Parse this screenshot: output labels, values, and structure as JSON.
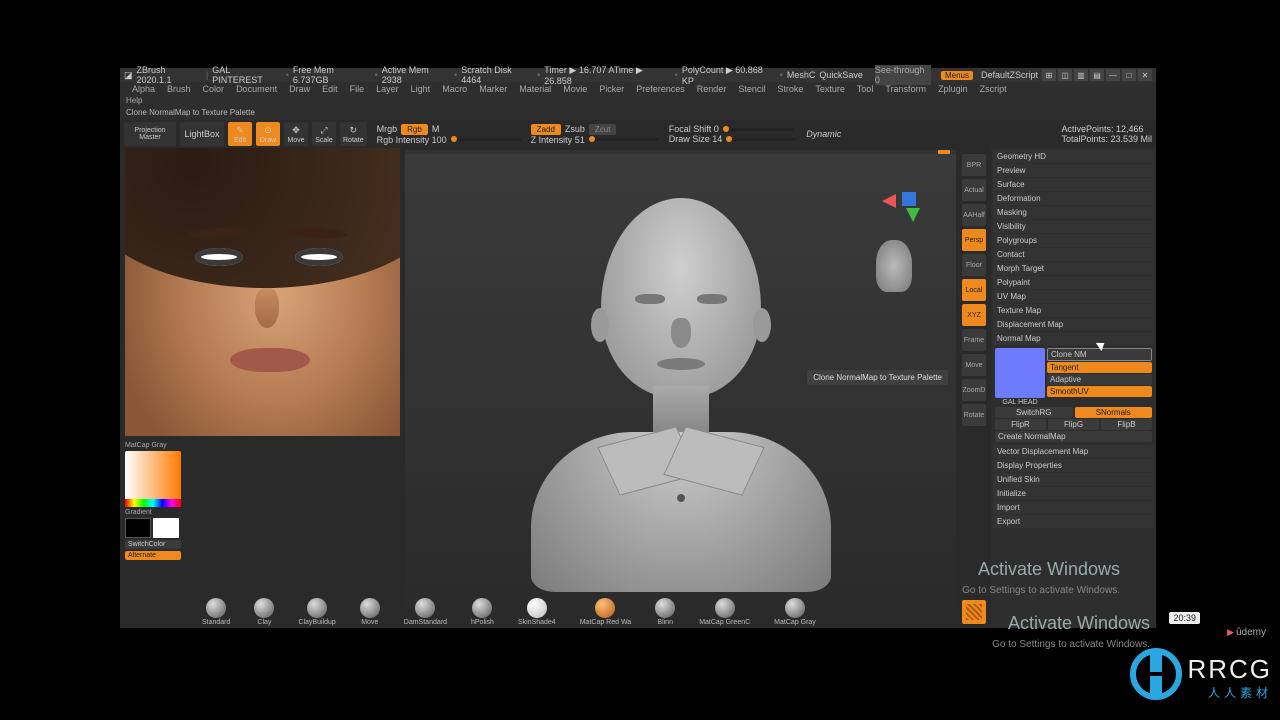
{
  "titlebar": {
    "app": "ZBrush 2020.1.1",
    "doc": "GAL PINTEREST",
    "stats": [
      "Free Mem 6.737GB",
      "Active Mem 2938",
      "Scratch Disk 4464",
      "Timer ▶ 16.707 ATime ▶ 26.858",
      "PolyCount ▶ 60.868 KP",
      "MeshC"
    ],
    "quicksave": "QuickSave",
    "seethrough": "See-through  0",
    "menus": "Menus",
    "zscript": "DefaultZScript"
  },
  "menus": [
    "Alpha",
    "Brush",
    "Color",
    "Document",
    "Draw",
    "Edit",
    "File",
    "Layer",
    "Light",
    "Macro",
    "Marker",
    "Material",
    "Movie",
    "Picker",
    "Preferences",
    "Render",
    "Stencil",
    "Stroke",
    "Texture",
    "Tool",
    "Transform",
    "Zplugin",
    "Zscript"
  ],
  "helpbar": "Help",
  "subinfo": "Clone NormalMap to Texture Palette",
  "toolbar": {
    "projection": "Projection\nMaster",
    "lightbox": "LightBox",
    "modeButtons": [
      "Edit",
      "Draw",
      "Move",
      "Scale",
      "Rotate"
    ],
    "mrgb": "Mrgb",
    "rgb": "Rgb",
    "m": "M",
    "rgbIntensity": "Rgb Intensity 100",
    "zadd": "Zadd",
    "zsub": "Zsub",
    "zcut": "Zcut",
    "zIntensity": "Z Intensity 51",
    "focal": "Focal Shift 0",
    "drawsize": "Draw Size 14",
    "dynamic": "Dynamic",
    "activepoints": "ActivePoints: 12,466",
    "totalpoints": "TotalPoints: 23.539 Mil"
  },
  "canvas": {
    "tooltip": "Clone NormalMap to Texture Palette"
  },
  "rightIcons": [
    "BPR",
    "Actual",
    "AAHalf",
    "Persp",
    "Floor",
    "Local",
    "XYZ",
    "Frame",
    "Move",
    "ZoomD",
    "Rotate"
  ],
  "rightIconsHot": [
    false,
    false,
    false,
    true,
    false,
    true,
    true,
    false,
    false,
    false,
    false
  ],
  "sidepanel": {
    "items": [
      "Geometry HD",
      "Preview",
      "Surface",
      "Deformation",
      "Masking",
      "Visibility",
      "Polygroups",
      "Contact",
      "Morph Target",
      "Polypaint",
      "UV Map",
      "Texture Map",
      "Displacement Map",
      "Normal Map"
    ],
    "normalMap": {
      "header": "Normal Map",
      "thumbLabel": "GAL HEAD",
      "cloneNM": "Clone NM",
      "tangent": "Tangent",
      "adaptive": "Adaptive",
      "smoothUV": "SmoothUV",
      "switchRG": "SwitchRG",
      "snormals": "SNormals",
      "flipR": "FlipR",
      "flipG": "FlipG",
      "flipB": "FlipB",
      "create": "Create NormalMap"
    },
    "itemsBelow": [
      "Vector Displacement Map",
      "Display Properties",
      "Unified Skin",
      "Initialize",
      "Import",
      "Export"
    ]
  },
  "leftpanel": {
    "matcap": "MatCap Gray",
    "gradient": "Gradient",
    "switchcolor": "SwitchColor",
    "alternate": "Alternate"
  },
  "brushes": [
    "Standard",
    "Clay",
    "ClayBuildup",
    "Move",
    "DamStandard",
    "hPolish",
    "SkinShade4",
    "MatCap Red Wa",
    "Blinn",
    "MatCap GreenC",
    "MatCap Gray"
  ],
  "activation": {
    "big": "Activate Windows",
    "small": "Go to Settings to activate Windows."
  },
  "activation2": {
    "big": "Activate Windows",
    "small": "Go to Settings to activate Windows."
  },
  "timer": "20:39",
  "udemy": "ûdemy",
  "logo": {
    "txt1": "RRCG",
    "txt2": "人人素材"
  }
}
